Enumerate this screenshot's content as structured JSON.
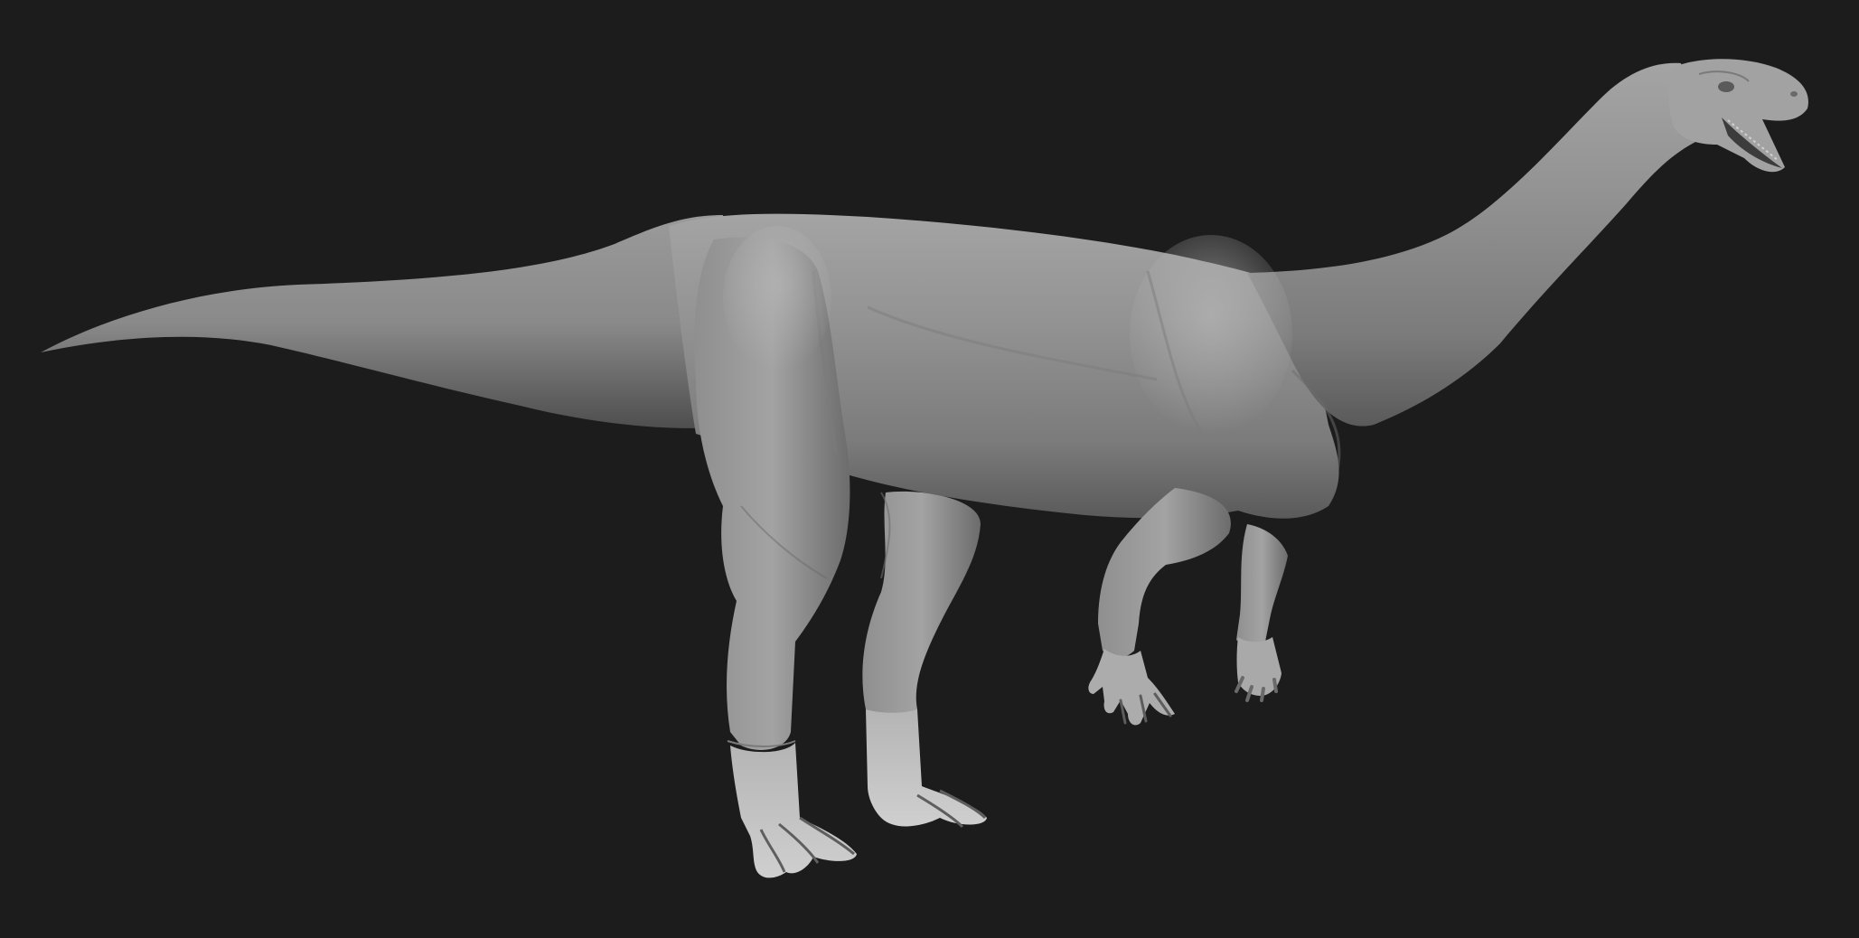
{
  "scene": {
    "background_color": "#1c1c1c",
    "material_color": "#8e8e8e",
    "subject": "dinosaur-sculpt"
  }
}
